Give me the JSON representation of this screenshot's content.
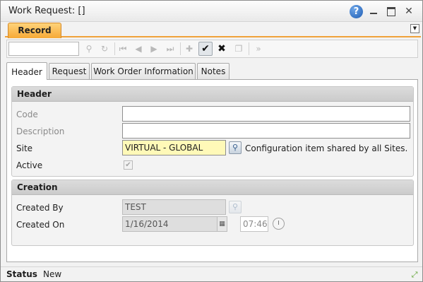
{
  "window": {
    "title": "Work Request: []",
    "help_icon": "help-icon",
    "minimize_icon": "minimize-icon",
    "maximize_icon": "maximize-icon",
    "close_icon": "close-icon",
    "close_glyph": "✕"
  },
  "record_tab": {
    "label": "Record",
    "color": "#f6a937"
  },
  "toolbar": {
    "search_value": "",
    "icons": [
      "search-icon",
      "refresh-icon",
      "first-record-icon",
      "previous-record-icon",
      "next-record-icon",
      "last-record-icon",
      "add-icon",
      "save-check-icon",
      "delete-x-icon",
      "copy-record-icon",
      "more-actions-icon"
    ]
  },
  "tabs": [
    {
      "label": "Header",
      "active": true
    },
    {
      "label": "Request",
      "active": false
    },
    {
      "label": "Work Order Information",
      "active": false
    },
    {
      "label": "Notes",
      "active": false
    }
  ],
  "header_section": {
    "title": "Header",
    "code_label": "Code",
    "code_value": "",
    "description_label": "Description",
    "description_value": "",
    "site_label": "Site",
    "site_value": "VIRTUAL - GLOBAL",
    "site_note": "Configuration item shared by all Sites.",
    "active_label": "Active",
    "active_checked": true
  },
  "creation_section": {
    "title": "Creation",
    "created_by_label": "Created By",
    "created_by_value": "TEST",
    "created_on_label": "Created On",
    "created_on_date": "1/16/2014",
    "created_on_time": "07:46"
  },
  "status": {
    "label": "Status",
    "value": "New"
  }
}
